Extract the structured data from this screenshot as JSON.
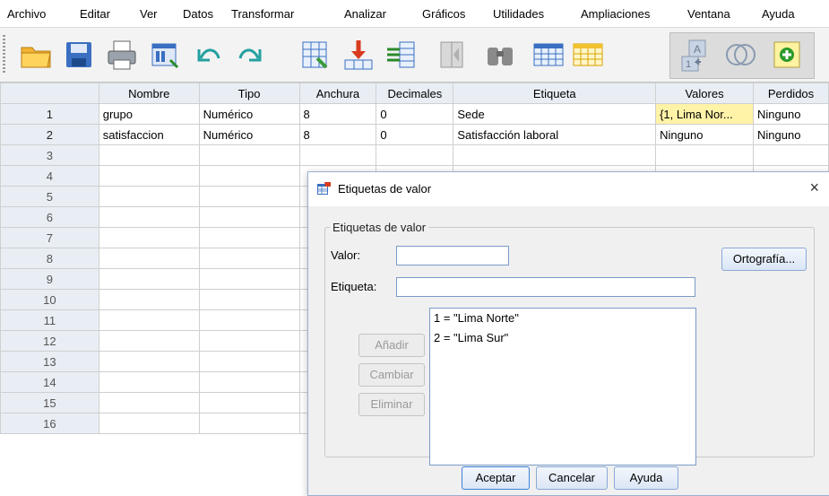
{
  "menu": [
    "Archivo",
    "Editar",
    "Ver",
    "Datos",
    "Transformar",
    "Analizar",
    "Gráficos",
    "Utilidades",
    "Ampliaciones",
    "Ventana",
    "Ayuda"
  ],
  "toolbar_icons": [
    "open-folder-icon",
    "save-icon",
    "print-icon",
    "recall-dialog-icon",
    "undo-icon",
    "redo-icon",
    "goto-case-icon",
    "goto-variable-icon",
    "variables-icon",
    "split-file-icon",
    "find-icon",
    "insert-cases-icon",
    "insert-variable-icon",
    "value-labels-icon",
    "use-sets-icon",
    "spelling-icon"
  ],
  "grid": {
    "columns": [
      "Nombre",
      "Tipo",
      "Anchura",
      "Decimales",
      "Etiqueta",
      "Valores",
      "Perdidos"
    ],
    "rows": [
      {
        "n": "1",
        "cells": [
          "grupo",
          "Numérico",
          "8",
          "0",
          "Sede",
          "{1, Lima Nor...",
          "Ninguno"
        ]
      },
      {
        "n": "2",
        "cells": [
          "satisfaccion",
          "Numérico",
          "8",
          "0",
          "Satisfacción laboral",
          "Ninguno",
          "Ninguno"
        ]
      },
      {
        "n": "3",
        "cells": [
          "",
          "",
          "",
          "",
          "",
          "",
          ""
        ]
      },
      {
        "n": "4",
        "cells": [
          "",
          "",
          "",
          "",
          "",
          "",
          ""
        ]
      },
      {
        "n": "5",
        "cells": [
          "",
          "",
          "",
          "",
          "",
          "",
          ""
        ]
      },
      {
        "n": "6",
        "cells": [
          "",
          "",
          "",
          "",
          "",
          "",
          ""
        ]
      },
      {
        "n": "7",
        "cells": [
          "",
          "",
          "",
          "",
          "",
          "",
          ""
        ]
      },
      {
        "n": "8",
        "cells": [
          "",
          "",
          "",
          "",
          "",
          "",
          ""
        ]
      },
      {
        "n": "9",
        "cells": [
          "",
          "",
          "",
          "",
          "",
          "",
          ""
        ]
      },
      {
        "n": "10",
        "cells": [
          "",
          "",
          "",
          "",
          "",
          "",
          ""
        ]
      },
      {
        "n": "11",
        "cells": [
          "",
          "",
          "",
          "",
          "",
          "",
          ""
        ]
      },
      {
        "n": "12",
        "cells": [
          "",
          "",
          "",
          "",
          "",
          "",
          ""
        ]
      },
      {
        "n": "13",
        "cells": [
          "",
          "",
          "",
          "",
          "",
          "",
          ""
        ]
      },
      {
        "n": "14",
        "cells": [
          "",
          "",
          "",
          "",
          "",
          "",
          ""
        ]
      },
      {
        "n": "15",
        "cells": [
          "",
          "",
          "",
          "",
          "",
          "",
          ""
        ]
      },
      {
        "n": "16",
        "cells": [
          "",
          "",
          "",
          "",
          "",
          "",
          ""
        ]
      }
    ]
  },
  "dialog": {
    "title": "Etiquetas de valor",
    "close": "×",
    "group_label": "Etiquetas de valor",
    "valor_label": "Valor:",
    "valor_value": "",
    "etiqueta_label": "Etiqueta:",
    "etiqueta_value": "",
    "spelling_button": "Ortografía...",
    "add_button": "Añadir",
    "change_button": "Cambiar",
    "remove_button": "Eliminar",
    "labels_list": [
      "1 = \"Lima Norte\"",
      "2 = \"Lima Sur\""
    ],
    "ok_button": "Aceptar",
    "cancel_button": "Cancelar",
    "help_button": "Ayuda"
  },
  "colors": {
    "highlight": "#fff3a8",
    "header_bg": "#e9eef5",
    "button_border": "#8aa8d6"
  }
}
